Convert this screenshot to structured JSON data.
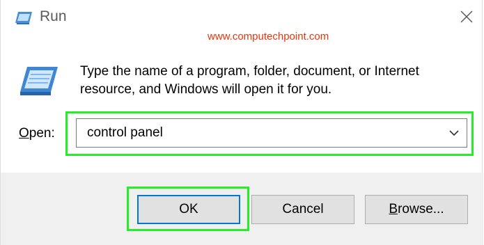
{
  "window": {
    "title": "Run",
    "watermark": "www.computechpoint.com",
    "prompt_line1": "Type the name of a program, folder, document, or Internet",
    "prompt_line2": "resource, and Windows will open it for you.",
    "icons": {
      "title": "run-app-icon",
      "large": "run-dialog-icon",
      "close": "close-icon",
      "dropdown": "chevron-down-icon"
    }
  },
  "open": {
    "label_mnemonic": "O",
    "label_rest": "pen:",
    "value": "control panel"
  },
  "buttons": {
    "ok": "OK",
    "cancel": "Cancel",
    "browse_mnemonic": "B",
    "browse_rest": "rowse..."
  },
  "colors": {
    "highlight": "#26ee26",
    "watermark": "#e8340c",
    "footer": "#f0f0f0",
    "focus_border": "#0078d7"
  }
}
